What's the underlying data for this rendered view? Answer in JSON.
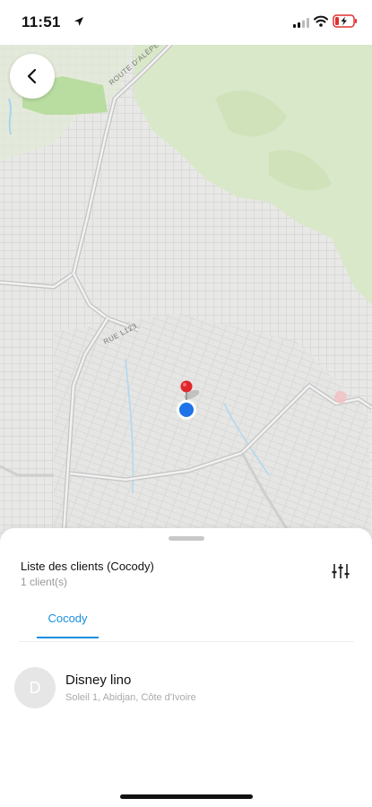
{
  "status_bar": {
    "time": "11:51",
    "icons": [
      "location-arrow-icon",
      "cellular-signal-icon",
      "wifi-icon",
      "battery-charging-icon"
    ]
  },
  "map": {
    "road_labels": [
      "ROUTE D'ALÈPE",
      "RUE L123"
    ],
    "colors": {
      "background": "#e8e8e6",
      "vegetation": "#d9e8c8",
      "park": "#b9dca0",
      "road": "#bdbdbd",
      "water": "#a7d4f0",
      "user_dot": "#1e73e8",
      "pin": "#e0262a"
    }
  },
  "back_button": {
    "icon": "chevron-left-icon"
  },
  "sheet": {
    "title": "Liste des clients (Cocody)",
    "count": "1 client(s)",
    "filter_icon": "sliders-icon",
    "tabs": [
      {
        "label": "Cocody",
        "active": true
      }
    ],
    "accent_color": "#1a8fe0",
    "clients": [
      {
        "initial": "D",
        "name": "Disney lino",
        "address": "Soleil 1, Abidjan, Côte d'Ivoire"
      }
    ]
  }
}
